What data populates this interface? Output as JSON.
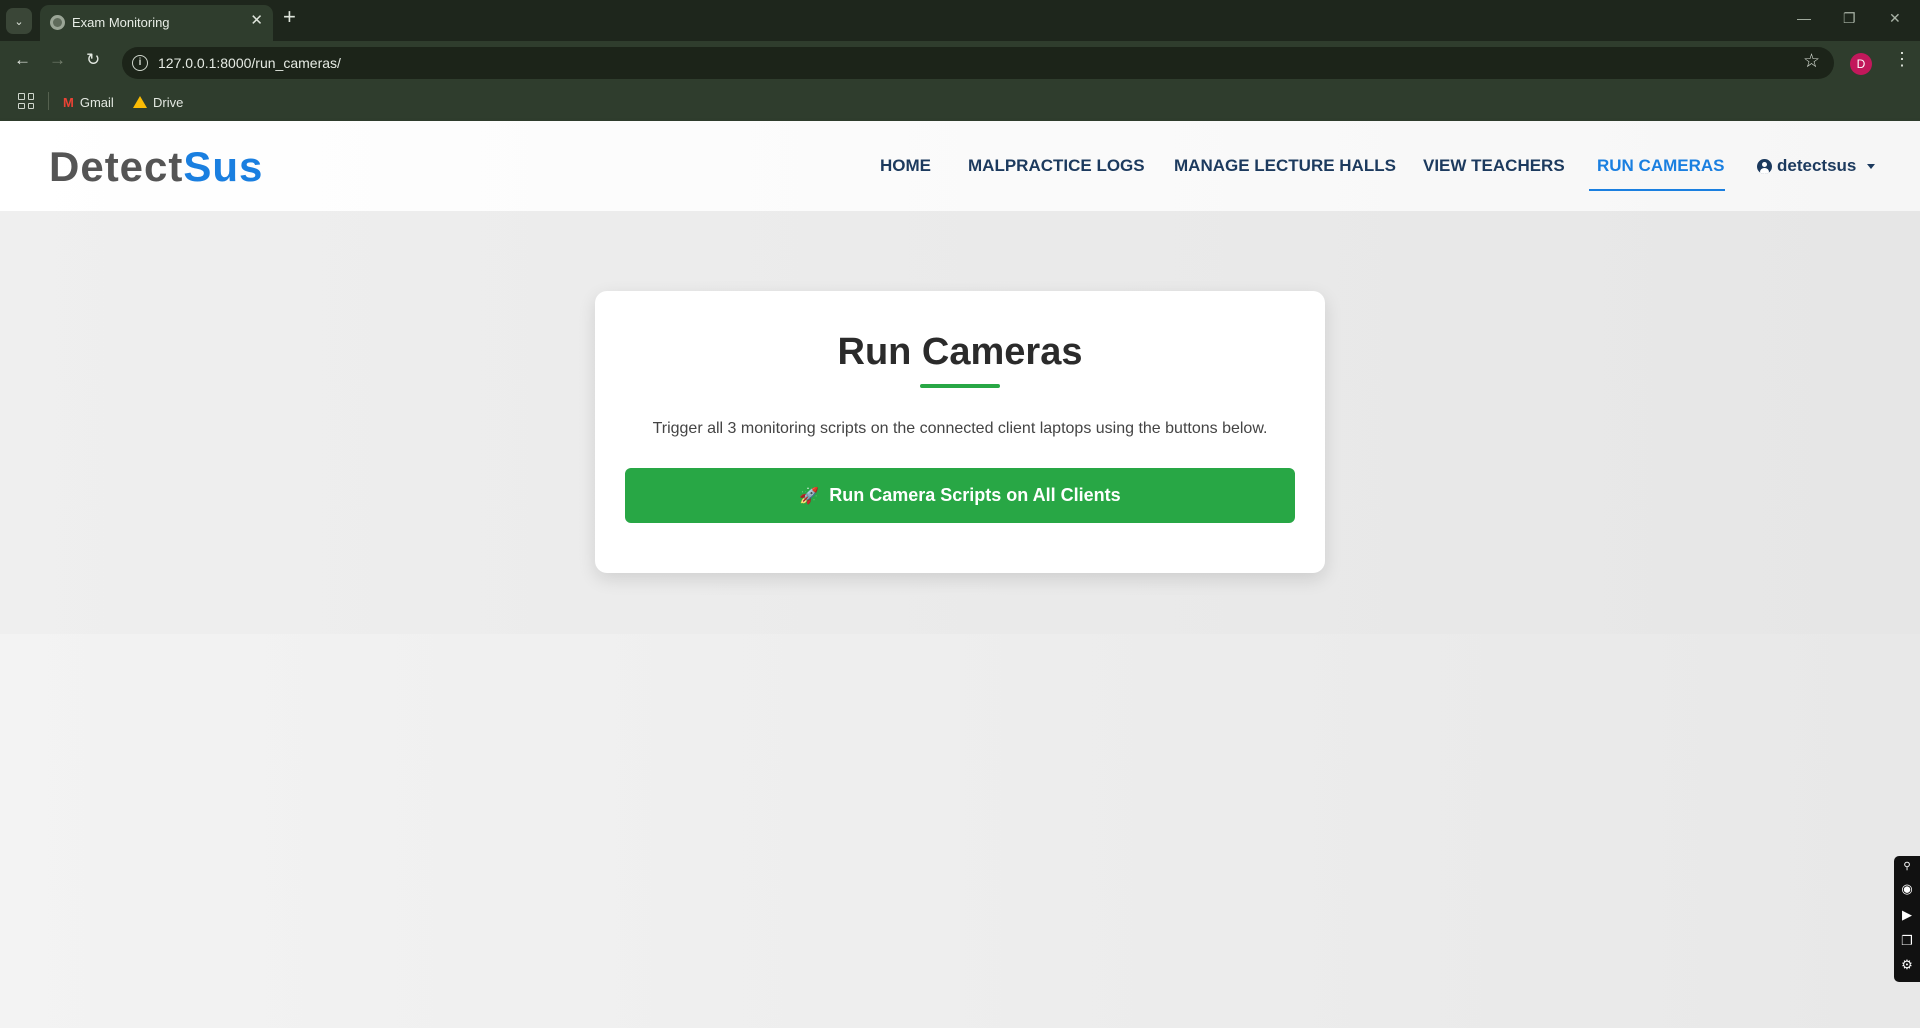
{
  "browser": {
    "tab_title": "Exam Monitoring",
    "tab_close": "✕",
    "new_tab": "+",
    "url": "127.0.0.1:8000/run_cameras/",
    "profile_initial": "D",
    "bookmarks": [
      {
        "label": "Gmail",
        "icon": "gmail-icon"
      },
      {
        "label": "Drive",
        "icon": "drive-icon"
      }
    ],
    "window_controls": {
      "minimize": "—",
      "restore": "❐",
      "close": "✕"
    }
  },
  "site": {
    "logo_part1": "Detect",
    "logo_part2": "Sus",
    "logo_colors": {
      "part1": "#555555",
      "part2": "#1a7fe0"
    },
    "nav": [
      {
        "label": "HOME",
        "active": false
      },
      {
        "label": "MALPRACTICE LOGS",
        "active": false
      },
      {
        "label": "MANAGE LECTURE HALLS",
        "active": false
      },
      {
        "label": "VIEW TEACHERS",
        "active": false
      },
      {
        "label": "RUN CAMERAS",
        "active": true
      }
    ],
    "user": "detectsus",
    "accent_color": "#1a7fe0"
  },
  "card": {
    "title": "Run Cameras",
    "description": "Trigger all 3 monitoring scripts on the connected client laptops using the buttons below.",
    "button_label": "Run Camera Scripts on All Clients",
    "button_icon": "🚀",
    "button_color": "#28a745"
  },
  "side_tools": [
    "link-icon",
    "camera-icon",
    "video-icon",
    "window-icon",
    "settings-icon"
  ]
}
